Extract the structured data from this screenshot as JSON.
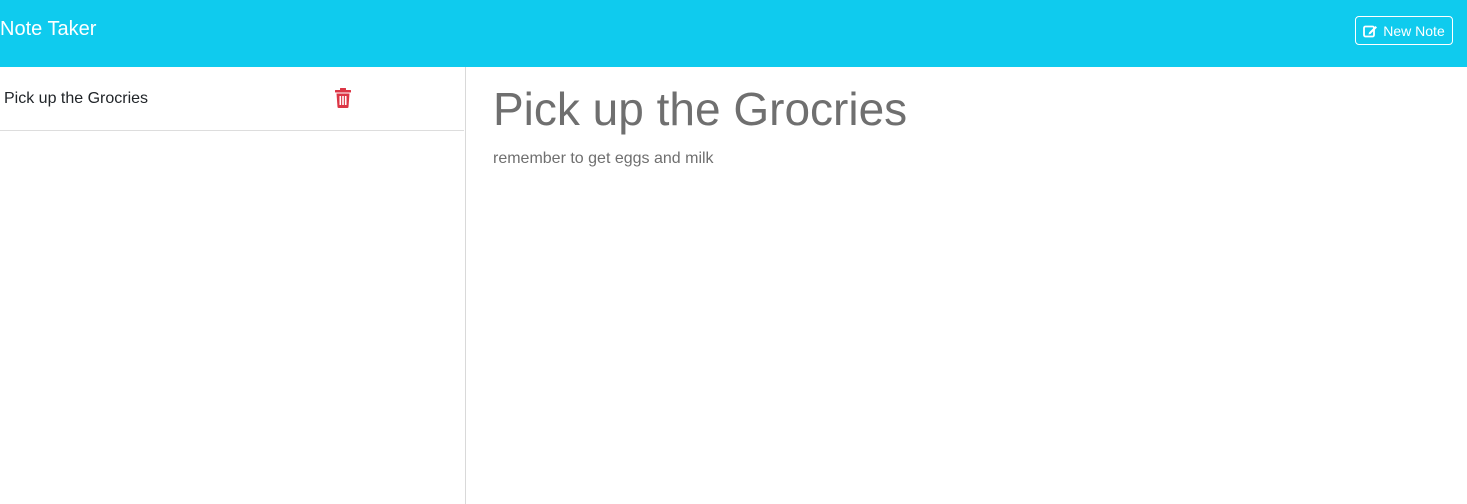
{
  "navbar": {
    "brand": "Note Taker",
    "new_note_label": "New Note",
    "background_color": "#0fcbee",
    "new_note_icon": "edit-icon"
  },
  "notes_list": {
    "items": [
      {
        "title": "Pick up the Grocries",
        "delete_icon": "trash-icon",
        "delete_icon_color": "#dc3545"
      }
    ]
  },
  "editor": {
    "title": "Pick up the Grocries",
    "text": "remember to get eggs and milk"
  }
}
